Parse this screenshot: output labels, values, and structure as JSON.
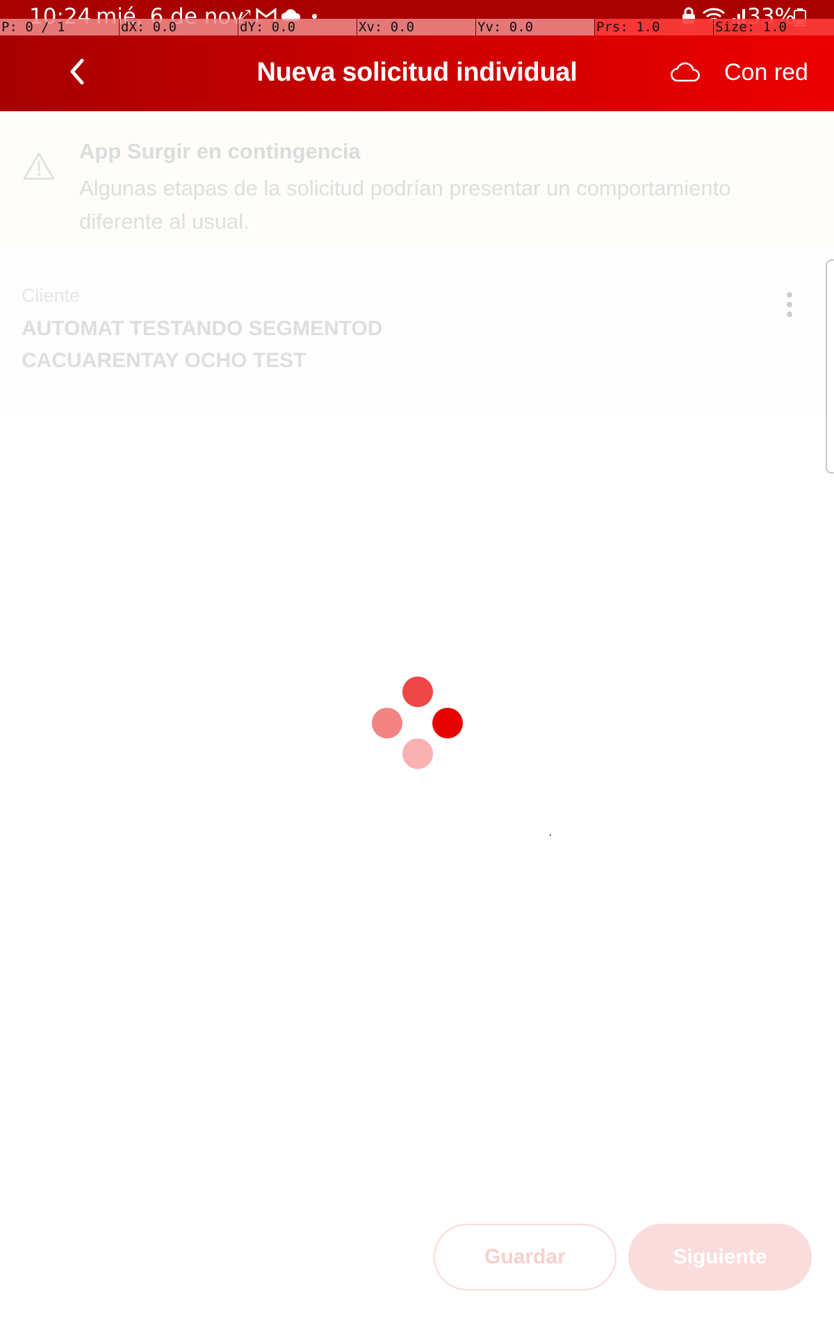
{
  "status_bar": {
    "time": "10:24",
    "date": "mié, 6 de nov",
    "battery": "33%",
    "icons": [
      "sync-icon",
      "gmail-icon",
      "cloud-icon",
      "dot-icon",
      "lock-icon",
      "wifi-icon",
      "signal-icon",
      "battery-icon"
    ]
  },
  "debug_overlay": {
    "pointer": "P: 0 / 1",
    "dx": "dX: 0.0",
    "dy": "dY: 0.0",
    "xv": "Xv: 0.0",
    "yv": "Yv: 0.0",
    "prs": "Prs: 1.0",
    "size": "Size: 1.0"
  },
  "header": {
    "title": "Nueva solicitud individual",
    "network_label": "Con red",
    "colors": {
      "start": "#a70000",
      "end": "#ec0000"
    }
  },
  "warning": {
    "title": "App Surgir en contingencia",
    "text": "Algunas etapas de la solicitud podrían presentar un comportamiento diferente al usual."
  },
  "client": {
    "label": "Cliente",
    "name": "AUTOMAT TESTANDO SEGMENTOD CACUARENTAY OCHO TEST"
  },
  "actions": {
    "save_label": "Guardar",
    "next_label": "Siguiente"
  },
  "colors": {
    "accent": "#ec0000"
  }
}
